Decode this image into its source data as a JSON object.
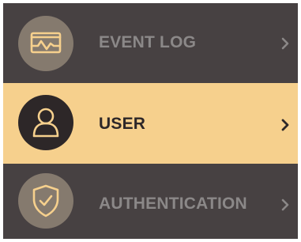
{
  "menu": {
    "items": [
      {
        "label": "EVENT LOG",
        "icon": "event-log-icon",
        "selected": false
      },
      {
        "label": "USER",
        "icon": "user-icon",
        "selected": true
      },
      {
        "label": "AUTHENTICATION",
        "icon": "shield-check-icon",
        "selected": false
      }
    ]
  },
  "colors": {
    "item_background": "#474142",
    "selected_background": "#f6d08d",
    "icon_circle": "#857a6e",
    "selected_icon_circle": "#2d2728",
    "icon_stroke": "#f6d08d",
    "label_inactive": "#8b8888",
    "label_active": "#2d2728"
  }
}
